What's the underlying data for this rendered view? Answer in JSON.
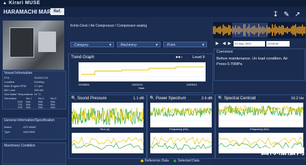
{
  "app": {
    "name": "Kirari MUSE"
  },
  "ship": {
    "name": "HARAMACHI MARU",
    "ref_label": "Ref."
  },
  "vessel": {
    "title": "Vessel Information",
    "rows": [
      {
        "label": "ETA",
        "value": "2023/07/24"
      },
      {
        "label": "Location",
        "value": "Docking"
      },
      {
        "label": "Main Engine RPM",
        "value": "17 rpm"
      },
      {
        "label": "ME Load",
        "value": "338 kW"
      },
      {
        "label": "Sea Water Temperature",
        "value": "24 °C"
      }
    ],
    "gen_label": "Generator",
    "gen_cols": [
      "No.1",
      "No.2",
      "No.3"
    ],
    "gen_rows": [
      {
        "label": "D/G",
        "values": [
          "N/A",
          "N/A",
          "N/A"
        ]
      },
      {
        "label": "T/G",
        "values": [
          "N/A",
          "N/A",
          "N/A"
        ]
      },
      {
        "label": "S/G",
        "values": [
          "N/A",
          "N/A",
          "N/A"
        ]
      }
    ]
  },
  "general": {
    "title": "General Information/Specification",
    "rows": [
      {
        "label": "Maker",
        "value": "ATS M/ME"
      },
      {
        "label": "Type",
        "value": "SAC0500"
      }
    ]
  },
  "machinery": {
    "title": "Machinery Condition"
  },
  "breadcrumb": "Kohin Deck / Air Compressor / Compressor analog",
  "selectors": [
    {
      "label": "-Category-"
    },
    {
      "label": "-Machinery-"
    },
    {
      "label": "-Point-"
    }
  ],
  "controls": {
    "date": "31 Aug. 2023",
    "time": "10:08:48",
    "play": "▶",
    "prev": "◀",
    "next": "▶"
  },
  "comment": {
    "title": "Comment",
    "text": "Before maintenance. Un load condition. Air Press:0.70MPa"
  },
  "trend": {
    "title": "Trend Graph",
    "level": "Level 9"
  },
  "charts": [
    {
      "title": "Sound Pressure",
      "value": "1.1 dB",
      "xlabel": "Time (s)"
    },
    {
      "title": "Power Spectrum",
      "value": "2.6 dB",
      "xlabel": "Frequency (Hz)"
    },
    {
      "title": "Spectral Centroid",
      "value": "10.2 Hz",
      "xlabel": "Frequency (Hz)"
    }
  ],
  "legend": {
    "ref": "Reference Data",
    "sel": "Selected Data"
  },
  "colors": {
    "ref": "#e7c600",
    "sel": "#27a63c",
    "bg": "#1d2f52"
  },
  "watermark": "国际船舶网",
  "chart_data": {
    "type": "line",
    "title": "Trend Graph",
    "xlabel": "Date",
    "categories": [
      "22/08/04",
      "23/02/13",
      "23/09/01"
    ],
    "series": [
      {
        "values": [
          0.35,
          0.55,
          0.55,
          0.62,
          0.62,
          0.72,
          0.72,
          0.8,
          0.8,
          0.86
        ]
      }
    ]
  }
}
